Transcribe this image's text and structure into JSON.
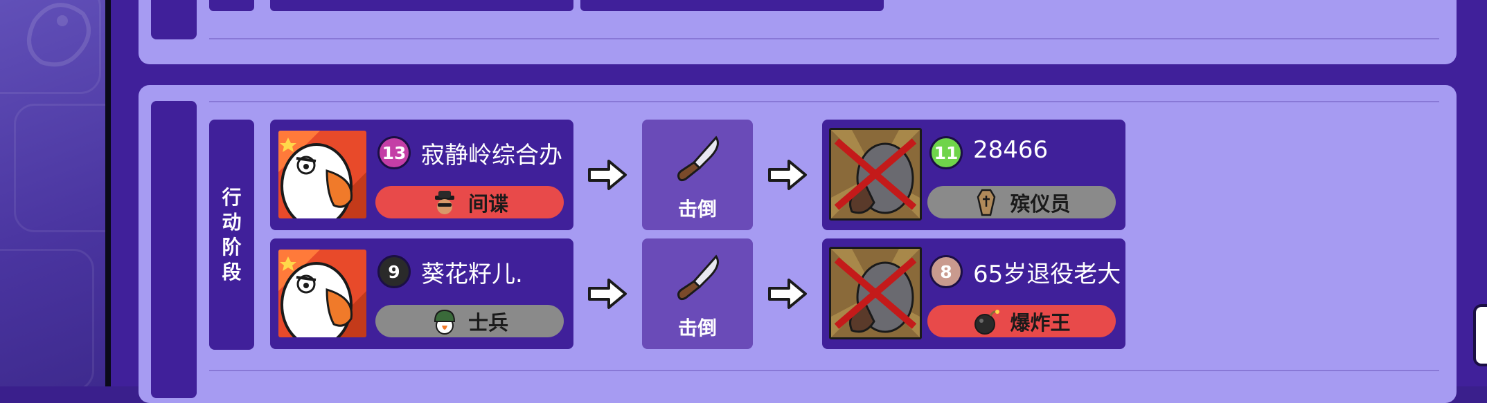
{
  "phase": {
    "label_chars": [
      "行",
      "动",
      "阶",
      "段"
    ]
  },
  "events": [
    {
      "actor": {
        "number": "13",
        "name": "寂静岭综合办",
        "role": "间谍",
        "role_icon": "spy-icon",
        "badge_color": "#c43ea6",
        "pill_color": "#e84a4a"
      },
      "action": {
        "label": "击倒",
        "icon": "knife-icon"
      },
      "target": {
        "number": "11",
        "name": "28466",
        "role": "殡仪员",
        "role_icon": "coffin-icon",
        "badge_color": "#6fd44a",
        "pill_color": "#8a8a8a",
        "eliminated": true
      }
    },
    {
      "actor": {
        "number": "9",
        "name": "葵花籽儿.",
        "role": "士兵",
        "role_icon": "soldier-helmet-icon",
        "badge_color": "#2a2a2a",
        "pill_color": "#8a8a8a"
      },
      "action": {
        "label": "击倒",
        "icon": "knife-icon"
      },
      "target": {
        "number": "8",
        "name": "65岁退役老大",
        "role": "爆炸王",
        "role_icon": "bomb-icon",
        "badge_color": "#c99a8e",
        "pill_color": "#e84a4a",
        "eliminated": true
      }
    }
  ],
  "colors": {
    "panel": "#a69bf2",
    "dark_purple": "#40209a",
    "action_box": "#6a4bb8",
    "red_pill": "#e84a4a",
    "grey_pill": "#8a8a8a"
  }
}
